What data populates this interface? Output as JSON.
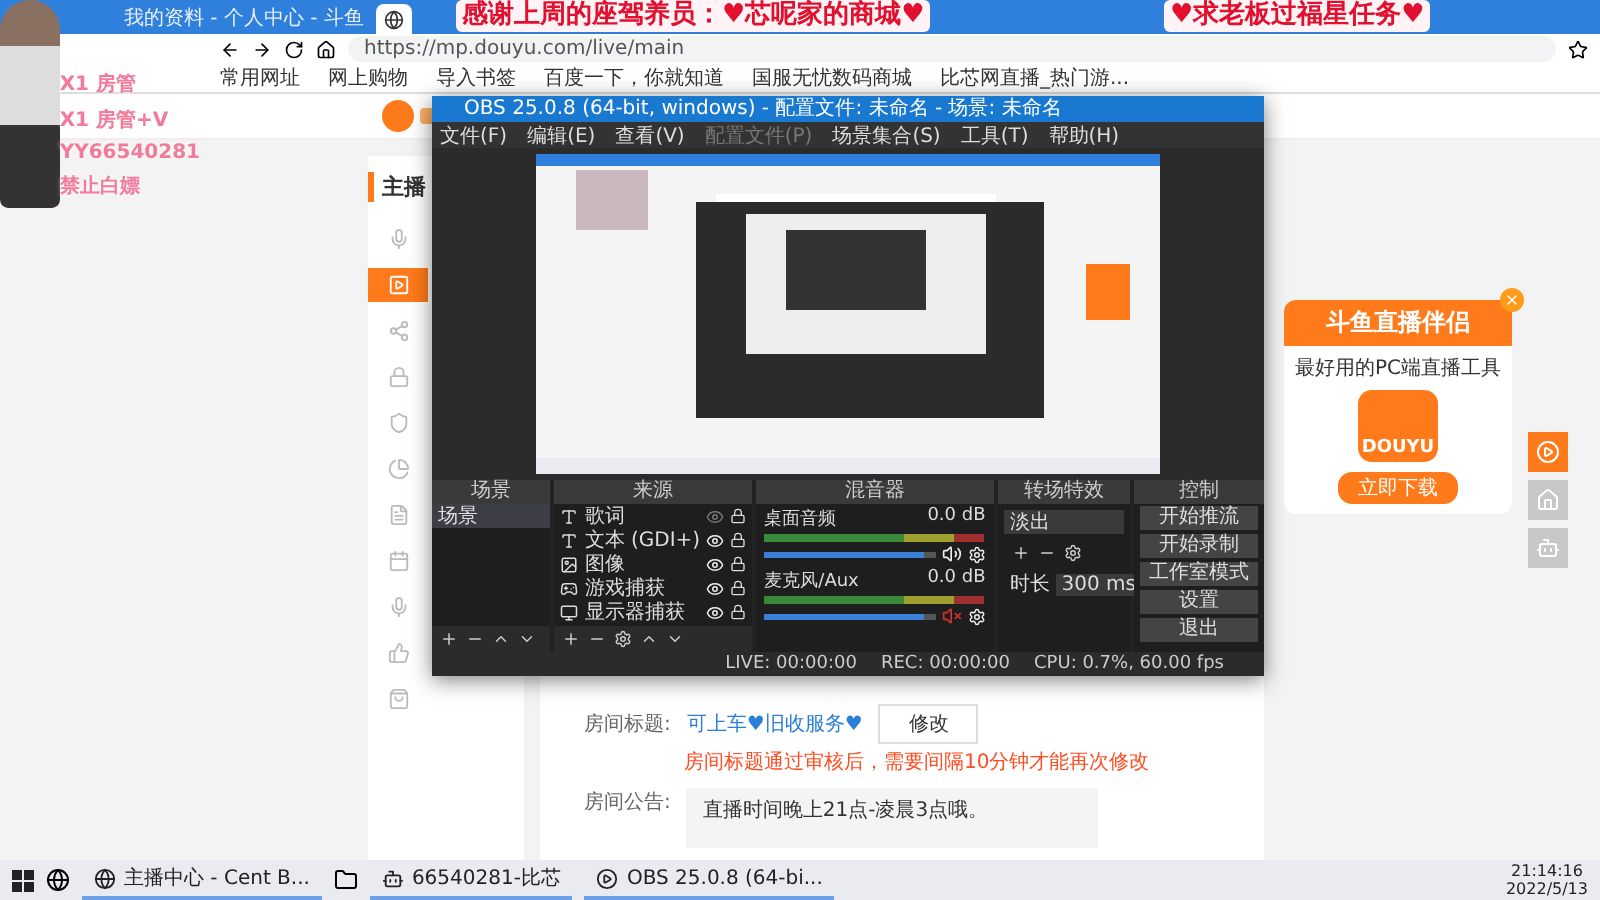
{
  "banner": {
    "left": "感谢上周的座驾养员：♥芯呢家的商城♥",
    "right": "♥求老板过福星任务♥"
  },
  "overlay": {
    "lines": [
      "X1 房管",
      "X1 房管+V",
      "YY66540281",
      "禁止白嫖"
    ]
  },
  "browser": {
    "tabs": [
      {
        "label": "我的资料 - 个人中心 - 斗鱼",
        "selected": false
      },
      {
        "selected": true
      }
    ],
    "url": "https://mp.douyu.com/live/main",
    "bookmarks": [
      "常用网址",
      "网上购物",
      "导入书签",
      "百度一下，你就知道",
      "国服无忧数码商城",
      "比芯网直播_热门游..."
    ]
  },
  "page": {
    "sidebar": {
      "title": "主播",
      "items": [
        {
          "kind": "mic",
          "selected": false
        },
        {
          "kind": "play",
          "selected": true
        },
        {
          "kind": "share",
          "selected": false
        },
        {
          "kind": "lock",
          "selected": false
        },
        {
          "kind": "shield",
          "selected": false
        },
        {
          "kind": "chart",
          "selected": false
        },
        {
          "kind": "file",
          "selected": false
        },
        {
          "kind": "calendar",
          "selected": false
        },
        {
          "kind": "mic",
          "selected": false
        },
        {
          "kind": "like",
          "selected": false
        },
        {
          "kind": "bag",
          "selected": false
        }
      ]
    },
    "room": {
      "title_label": "房间标题:",
      "title_value": "可上车♥旧收服务♥",
      "edit_button": "修改",
      "warning": "房间标题通过审核后，需要间隔10分钟才能再次修改",
      "notice_label": "房间公告:",
      "notice": "直播时间晚上21点-凌晨3点哦。"
    },
    "promo": {
      "title": "斗鱼直播伴侣",
      "subtitle": "最好用的PC端直播工具",
      "app": "DOUYU",
      "button": "立即下载"
    }
  },
  "obs": {
    "title": "OBS 25.0.8 (64-bit, windows) - 配置文件: 未命名 - 场景: 未命名",
    "menu": [
      {
        "label": "文件(F)",
        "disabled": false
      },
      {
        "label": "编辑(E)",
        "disabled": false
      },
      {
        "label": "查看(V)",
        "disabled": false
      },
      {
        "label": "配置文件(P)",
        "disabled": true
      },
      {
        "label": "场景集合(S)",
        "disabled": false
      },
      {
        "label": "工具(T)",
        "disabled": false
      },
      {
        "label": "帮助(H)",
        "disabled": false
      }
    ],
    "scenes": {
      "title": "场景",
      "items": [
        {
          "label": "场景",
          "selected": true
        }
      ]
    },
    "sources": {
      "title": "来源",
      "items": [
        {
          "kind": "text",
          "label": "歌词",
          "visible": false
        },
        {
          "kind": "text",
          "label": "文本 (GDI+)",
          "visible": true
        },
        {
          "kind": "image",
          "label": "图像",
          "visible": true
        },
        {
          "kind": "game",
          "label": "游戏捕获",
          "visible": true
        },
        {
          "kind": "monitor",
          "label": "显示器捕获",
          "visible": true
        }
      ]
    },
    "mixer": {
      "title": "混音器",
      "channels": [
        {
          "name": "桌面音频",
          "reading": "0.0 dB",
          "level": 0.93,
          "muted": false
        },
        {
          "name": "麦克风/Aux",
          "reading": "0.0 dB",
          "level": 0.93,
          "muted": true
        }
      ]
    },
    "transitions": {
      "title": "转场特效",
      "type": "淡出",
      "duration_label": "时长",
      "duration": "300 ms"
    },
    "controls": {
      "title": "控制",
      "buttons": [
        "开始推流",
        "开始录制",
        "工作室模式",
        "设置",
        "退出"
      ]
    },
    "status": {
      "live": "LIVE: 00:00:00",
      "rec": "REC: 00:00:00",
      "cpu": "CPU: 0.7%, 60.00 fps"
    }
  },
  "taskbar": {
    "apps": [
      {
        "kind": "browser",
        "label": "主播中心 - Cent B..."
      },
      {
        "kind": "folder"
      },
      {
        "kind": "app",
        "label": "66540281-比芯"
      },
      {
        "kind": "obs",
        "label": "OBS 25.0.8 (64-bi..."
      }
    ],
    "time": "21:14:16",
    "date": "2022/5/13"
  }
}
